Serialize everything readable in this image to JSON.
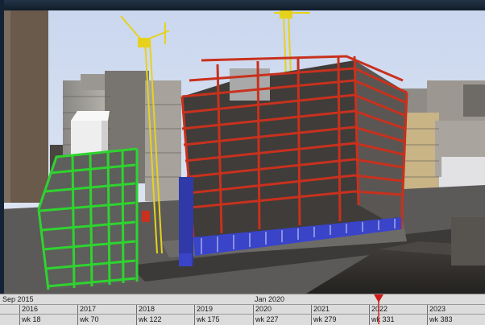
{
  "timeline": {
    "start_label": "Sep 2015",
    "mid_label": "Jan 2020",
    "years": [
      "2016",
      "2017",
      "2018",
      "2019",
      "2020",
      "2021",
      "2022",
      "2023"
    ],
    "weeks": [
      "wk 18",
      "wk 70",
      "wk 122",
      "wk 175",
      "wk 227",
      "wk 279",
      "wk 331",
      "wk 383"
    ],
    "current_week": "wk 331"
  },
  "colors": {
    "current_steel": "#c8311d",
    "completed_steel": "#2fd32f",
    "crane": "#e6d21d",
    "curtain_wall": "#3a44c9",
    "playhead": "#d01919"
  }
}
